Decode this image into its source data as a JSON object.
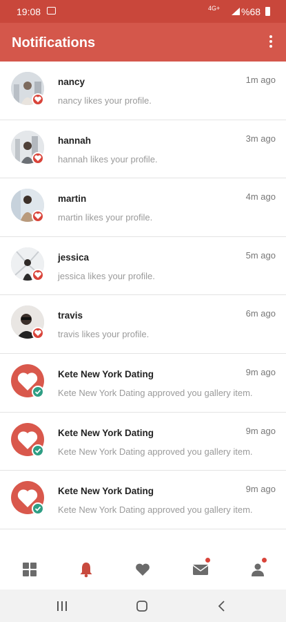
{
  "status_bar": {
    "time": "19:08",
    "network": "4G+",
    "battery": "%68"
  },
  "header": {
    "title": "Notifications"
  },
  "notifications": [
    {
      "name": "nancy",
      "message": "nancy likes your profile.",
      "time": "1m ago",
      "type": "like"
    },
    {
      "name": "hannah",
      "message": "hannah likes your profile.",
      "time": "3m ago",
      "type": "like"
    },
    {
      "name": "martin",
      "message": "martin likes your profile.",
      "time": "4m ago",
      "type": "like"
    },
    {
      "name": "jessica",
      "message": "jessica likes your profile.",
      "time": "5m ago",
      "type": "like"
    },
    {
      "name": "travis",
      "message": "travis likes your profile.",
      "time": "6m ago",
      "type": "like"
    },
    {
      "name": "Kete New York Dating",
      "message": "Kete New York Dating approved you gallery item.",
      "time": "9m ago",
      "type": "approved"
    },
    {
      "name": "Kete New York Dating",
      "message": "Kete New York Dating approved you gallery item.",
      "time": "9m ago",
      "type": "approved"
    },
    {
      "name": "Kete New York Dating",
      "message": "Kete New York Dating approved you gallery item.",
      "time": "9m ago",
      "type": "approved"
    }
  ],
  "bottom_nav": [
    {
      "icon": "grid-icon",
      "active": false,
      "dot": false
    },
    {
      "icon": "bell-icon",
      "active": true,
      "dot": false
    },
    {
      "icon": "heart-icon",
      "active": false,
      "dot": false
    },
    {
      "icon": "mail-icon",
      "active": false,
      "dot": true
    },
    {
      "icon": "person-icon",
      "active": false,
      "dot": true
    }
  ],
  "colors": {
    "status_bar": "#c9473b",
    "app_bar": "#d4574b",
    "accent": "#c84a3e",
    "inactive_icon": "#6b6b6b",
    "like_badge": "#d9443a",
    "approved_badge": "#2e9e84"
  }
}
